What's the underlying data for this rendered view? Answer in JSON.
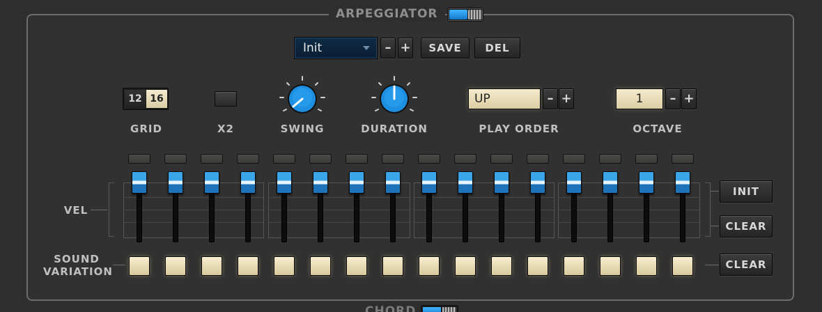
{
  "section": {
    "title": "ARPEGGIATOR",
    "enabled": true
  },
  "preset": {
    "value": "Init",
    "minus": "–",
    "plus": "+",
    "save": "SAVE",
    "del": "DEL"
  },
  "grid": {
    "label": "GRID",
    "options": [
      "12",
      "16"
    ],
    "selected": "16"
  },
  "x2": {
    "label": "X2"
  },
  "swing": {
    "label": "SWING"
  },
  "duration": {
    "label": "DURATION"
  },
  "play_order": {
    "label": "PLAY ORDER",
    "value": "UP",
    "minus": "–",
    "plus": "+"
  },
  "octave": {
    "label": "OCTAVE",
    "value": "1",
    "minus": "–",
    "plus": "+"
  },
  "vel": {
    "label": "VEL",
    "init": "INIT",
    "clear": "CLEAR"
  },
  "sound_variation": {
    "label_line1": "SOUND",
    "label_line2": "VARIATION",
    "clear": "CLEAR"
  },
  "steps": {
    "count": 16,
    "velocity_levels": [
      1,
      1,
      1,
      1,
      1,
      1,
      1,
      1,
      1,
      1,
      1,
      1,
      1,
      1,
      1,
      1
    ]
  },
  "colors": {
    "accent": "#1e8fe0",
    "pad": "#e9dfb8",
    "panel": "#313131"
  },
  "next_section": {
    "title": "CHORD",
    "enabled": true
  }
}
